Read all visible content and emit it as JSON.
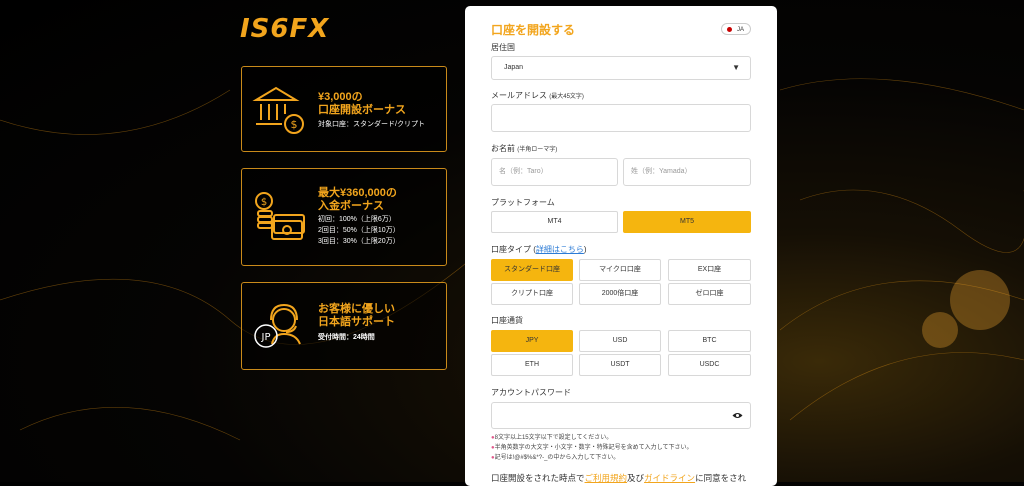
{
  "brand": {
    "logo_text": "IS6FX"
  },
  "promos": [
    {
      "title1": "¥3,000の",
      "title2": "口座開設ボーナス",
      "line1": "対象口座：スタンダード/クリプト"
    },
    {
      "title1": "最大¥360,000の",
      "title2": "入金ボーナス",
      "line1": "初回：100%（上限6万）",
      "line2": "2回目：50%（上限10万）",
      "line3": "3回目：30%（上限20万）"
    },
    {
      "title1": "お客様に優しい",
      "title2": "日本語サポート",
      "line1": "受付時間：24時間",
      "badge": "JP"
    }
  ],
  "form": {
    "title": "口座を開設する",
    "lang": "JA",
    "country_label": "居住国",
    "country_value": "Japan",
    "email_label": "メールアドレス",
    "email_hint": "(最大45文字)",
    "name_label": "お名前",
    "name_hint": "(半角ローマ字)",
    "first_placeholder": "名（例：Taro）",
    "last_placeholder": "姓（例：Yamada）",
    "platform_label": "プラットフォーム",
    "platforms": [
      "MT4",
      "MT5"
    ],
    "account_type_label": "口座タイプ",
    "account_type_link": "詳細はこちら",
    "account_types": [
      "スタンダード口座",
      "マイクロ口座",
      "EX口座",
      "クリプト口座",
      "2000倍口座",
      "ゼロ口座"
    ],
    "currency_label": "口座通貨",
    "currencies": [
      "JPY",
      "USD",
      "BTC",
      "ETH",
      "USDT",
      "USDC"
    ],
    "password_label": "アカウントパスワード",
    "notes": [
      "8文字以上15文字以下で設定してください。",
      "半角英数字の大文字・小文字・数字・特殊記号を含めて入力して下さい。",
      "記号は!@#$%&*?-_の中から入力して下さい。"
    ],
    "agree_prefix": "口座開設をされた時点で",
    "agree_terms": "ご利用規約",
    "agree_and": "及び",
    "agree_guide": "ガイドライン",
    "agree_suffix": "に同意をされ"
  },
  "colors": {
    "accent": "#f2a51d",
    "selected": "#f5b50f"
  },
  "icons": [
    "bank-coin-icon",
    "money-stack-icon",
    "support-headset-icon",
    "dropdown-caret-icon",
    "eye-icon"
  ]
}
